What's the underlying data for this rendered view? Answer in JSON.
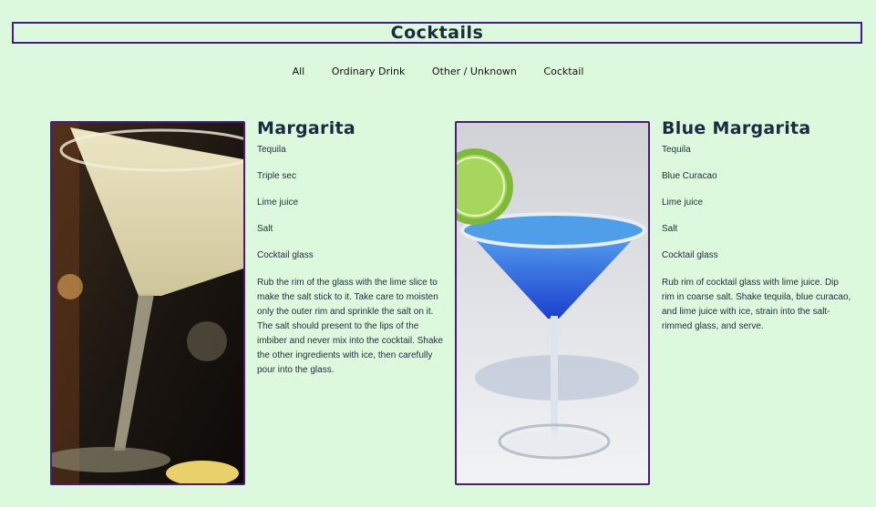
{
  "header": {
    "title": "Cocktails"
  },
  "filters": [
    "All",
    "Ordinary Drink",
    "Other / Unknown",
    "Cocktail"
  ],
  "cards": [
    {
      "name": "Margarita",
      "ingredients": [
        "Tequila",
        "Triple sec",
        "Lime juice",
        "Salt",
        "Cocktail glass"
      ],
      "instructions": "Rub the rim of the glass with the lime slice to make the salt stick to it. Take care to moisten only the outer rim and sprinkle the salt on it. The salt should present to the lips of the imbiber and never mix into the cocktail. Shake the other ingredients with ice, then carefully pour into the glass."
    },
    {
      "name": "Blue Margarita",
      "ingredients": [
        "Tequila",
        "Blue Curacao",
        "Lime juice",
        "Salt",
        "Cocktail glass"
      ],
      "instructions": "Rub rim of cocktail glass with lime juice. Dip rim in coarse salt. Shake tequila, blue curacao, and lime juice with ice, strain into the salt-rimmed glass, and serve."
    }
  ]
}
